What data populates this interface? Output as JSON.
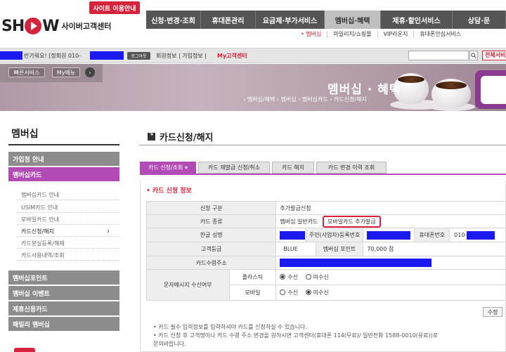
{
  "header": {
    "site_guide": "사이트 이용안내",
    "logo_text": "SH",
    "logo_text2": "W",
    "logo_sub": "사이버고객센터",
    "gnb": [
      {
        "label": "신청·변경·조회"
      },
      {
        "label": "휴대폰관리"
      },
      {
        "label": "요금제·부가서비스"
      },
      {
        "label": "멤버십·혜택"
      },
      {
        "label": "제휴·할인서비스"
      },
      {
        "label": "상담·문"
      }
    ],
    "sub_gnb": [
      {
        "label": "• 멤버십"
      },
      {
        "label": "마일리지/쇼핑몰"
      },
      {
        "label": "VIP라운지"
      },
      {
        "label": "휴대폰안심서비스"
      }
    ]
  },
  "userbar": {
    "greeting": "반가워요! [정회원 010-",
    "logout": "로그아웃",
    "links": "회원정보 | 가입정보 | ",
    "my_center": "My고객센터",
    "search_icon": "search-icon",
    "all_service": "전체서비스"
  },
  "banner": {
    "quick_service": "빠른서비스",
    "my_menu": "My메뉴",
    "title": "멤버십 · 혜택",
    "breadcrumb": "› 멤버십/혜택 › 멤버십 › 멤버십카드 › 카드신청/해지"
  },
  "sidebar": {
    "title": "멤버십",
    "menus": [
      {
        "label": "가입정 안내"
      },
      {
        "label": "멤버십카드"
      }
    ],
    "subs": [
      {
        "label": "멤버십카드 안내"
      },
      {
        "label": "USIM카드 안내"
      },
      {
        "label": "모바일카드 안내"
      },
      {
        "label": "카드신청/해지"
      },
      {
        "label": "카드분실등록/해제"
      },
      {
        "label": "카드사용내역/조회"
      }
    ],
    "menus2": [
      {
        "label": "멤버십포인트"
      },
      {
        "label": "멤버십 이벤트"
      },
      {
        "label": "제휴신용카드"
      },
      {
        "label": "패밀리 멤버십"
      }
    ]
  },
  "content": {
    "title": "카드신청/해지",
    "tabs": [
      {
        "label": "카드 신청/조회 ▾"
      },
      {
        "label": "카드 재발급 신청/취소"
      },
      {
        "label": "카드 해지"
      },
      {
        "label": "카드 변경 이력 조회"
      }
    ],
    "section_title": "• 카드 신청 정보",
    "rows": {
      "apply_type_label": "신청 구분",
      "apply_type_value": "추가발급신청",
      "card_type_label": "카드 종류",
      "card_type_value": "멤버십 일반카드",
      "card_type_highlight": "모바일카드 추가발급",
      "name_label": "한글 성명",
      "rrn_label": "주민(사업자)등록번호",
      "phone_label": "휴대폰번호",
      "phone_prefix": "010-",
      "grade_label": "고객등급",
      "grade_value": "BLUE",
      "points_label": "멤버십 포인트",
      "points_value": "70,000 점",
      "address_label": "카드수령주소",
      "sms_label": "문자메시지 수신여부",
      "plastic_label": "플라스틱",
      "mobile_label": "모바일",
      "receive": "수신",
      "not_receive": "미수신"
    },
    "edit_button": "수정",
    "notes": [
      "• 카드 필수 입력정보를 입력하셔야 카드를 신청하실 수 있습니다.",
      "• 카드 신청 후 고객명이나 카드 수령 주소 변경을 원하시면 고객센터(휴대폰 114(무료)/ 일반전화 1588-0010(유료))로",
      "  문의바랍니다."
    ]
  },
  "colors": {
    "brand_red": "#d6223a",
    "accent_purple": "#b24bb5",
    "redaction_blue": "#1a1af0"
  }
}
